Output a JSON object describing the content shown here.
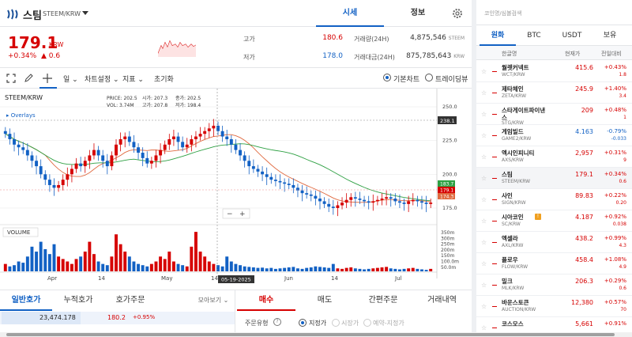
{
  "header": {
    "coin_name": "스팀",
    "pair": "STEEM/KRW",
    "tabs": [
      "시세",
      "정보"
    ]
  },
  "price": {
    "current": "179.1",
    "unit": "KRW",
    "change_pct": "+0.34%",
    "change_abs": "▲ 0.6",
    "high_label": "고가",
    "high": "180.6",
    "low_label": "저가",
    "low": "178.0",
    "volume_label": "거래량(24H)",
    "volume": "4,875,546",
    "volume_unit": "STEEM",
    "amount_label": "거래대금(24H)",
    "amount": "875,785,643",
    "amount_unit": "KRW"
  },
  "toolbar": {
    "period": "일",
    "chart_settings": "차트설정",
    "indicator": "지표",
    "reset": "초기화",
    "basic_chart": "기본차트",
    "trading_view": "트레이딩뷰"
  },
  "chart_data": {
    "type": "candlestick",
    "title": "STEEM/KRW",
    "overlays_label": "Overlays",
    "ohlc_labels": {
      "price_label": "PRICE:",
      "price": "202.5",
      "open_label": "시가:",
      "open": "207.3",
      "close_label": "종가:",
      "close": "202.5",
      "vol_label": "VOL:",
      "vol": "3.74M",
      "high_label": "고가:",
      "high": "207.8",
      "low_label": "저가:",
      "low": "198.4"
    },
    "y_ticks": [
      "250.0",
      "225.0",
      "200.0",
      "175.0"
    ],
    "ylim": [
      165,
      260
    ],
    "crosshair_value": "238.1",
    "price_tags": [
      "183.7",
      "179.1",
      "174.3"
    ],
    "x_ticks": [
      "Apr",
      "14",
      "May",
      "14",
      "Jun",
      "14",
      "Jul"
    ],
    "crosshair_date": "05-19-2025",
    "volume_label": "VOLUME",
    "volume_ticks": [
      "350m",
      "300m",
      "250m",
      "200m",
      "150m",
      "100.0m",
      "50.0m"
    ],
    "closes": [
      230,
      226,
      222,
      220,
      218,
      214,
      210,
      206,
      200,
      196,
      192,
      190,
      192,
      196,
      200,
      204,
      208,
      206,
      210,
      214,
      218,
      214,
      210,
      206,
      214,
      222,
      226,
      228,
      224,
      220,
      216,
      212,
      208,
      210,
      214,
      218,
      222,
      226,
      228,
      224,
      220,
      222,
      226,
      228,
      230,
      232,
      234,
      236,
      232,
      228,
      226,
      222,
      218,
      214,
      210,
      206,
      204,
      202,
      200,
      198,
      196,
      195,
      194,
      193,
      192,
      190,
      188,
      186,
      185,
      184,
      182,
      180,
      178,
      176,
      175,
      177,
      179,
      181,
      183,
      182,
      181,
      180,
      179,
      180,
      181,
      182,
      183,
      182,
      180,
      179,
      178,
      180,
      181,
      180,
      179,
      178,
      179
    ],
    "volumes": [
      30,
      20,
      25,
      40,
      35,
      60,
      100,
      80,
      120,
      90,
      70,
      110,
      60,
      50,
      40,
      30,
      50,
      60,
      80,
      120,
      70,
      40,
      30,
      25,
      60,
      150,
      110,
      80,
      60,
      40,
      30,
      25,
      20,
      30,
      40,
      60,
      50,
      80,
      40,
      30,
      25,
      20,
      100,
      160,
      80,
      60,
      40,
      30,
      25,
      20,
      60,
      40,
      30,
      25,
      20,
      18,
      16,
      14,
      15,
      12,
      14,
      10,
      12,
      14,
      16,
      18,
      12,
      10,
      14,
      16,
      20,
      18,
      16,
      14,
      30,
      12,
      10,
      14,
      16,
      12,
      10,
      8,
      10,
      12,
      14,
      16,
      18,
      12,
      10,
      8,
      10,
      12,
      14,
      10,
      8,
      6,
      10
    ]
  },
  "bottom_tabs": {
    "left": [
      "일반호가",
      "누적호가",
      "호가주문"
    ],
    "view_more": "모아보기",
    "right": [
      "매수",
      "매도",
      "간편주문",
      "거래내역"
    ]
  },
  "orderbook": {
    "volume": "23,474.178",
    "price": "180.2",
    "pct": "+0.95%"
  },
  "order_form": {
    "type_label": "주문유형",
    "options": [
      "지정가",
      "시장가",
      "예약-지정가"
    ]
  },
  "market": {
    "search_placeholder": "코인명/심볼검색",
    "tabs": [
      "원화",
      "BTC",
      "USDT",
      "보유"
    ],
    "headers": [
      "한글명",
      "현재가",
      "전일대비"
    ],
    "rows": [
      {
        "name": "월렛커넥트",
        "pair": "WCT/KRW",
        "price": "415.6",
        "pct": "+0.43%",
        "diff": "1.8",
        "dir": "up"
      },
      {
        "name": "제타체인",
        "pair": "ZETA/KRW",
        "price": "245.9",
        "pct": "+1.40%",
        "diff": "3.4",
        "dir": "up"
      },
      {
        "name": "스타게이트파이낸스",
        "pair": "STG/KRW",
        "price": "209",
        "pct": "+0.48%",
        "diff": "1",
        "dir": "up"
      },
      {
        "name": "게임빌드",
        "pair": "GAME2/KRW",
        "price": "4.163",
        "pct": "-0.79%",
        "diff": "-0.033",
        "dir": "down"
      },
      {
        "name": "엑시인피니티",
        "pair": "AXS/KRW",
        "price": "2,957",
        "pct": "+0.31%",
        "diff": "9",
        "dir": "up"
      },
      {
        "name": "스팀",
        "pair": "STEEM/KRW",
        "price": "179.1",
        "pct": "+0.34%",
        "diff": "0.6",
        "dir": "up"
      },
      {
        "name": "사인",
        "pair": "SIGN/KRW",
        "price": "89.83",
        "pct": "+0.22%",
        "diff": "0.20",
        "dir": "up"
      },
      {
        "name": "시아코인",
        "pair": "SC/KRW",
        "price": "4.187",
        "pct": "+0.92%",
        "diff": "0.038",
        "dir": "up"
      },
      {
        "name": "엑셀라",
        "pair": "AXL/KRW",
        "price": "438.2",
        "pct": "+0.99%",
        "diff": "4.3",
        "dir": "up"
      },
      {
        "name": "플로우",
        "pair": "FLOW/KRW",
        "price": "458.4",
        "pct": "+1.08%",
        "diff": "4.9",
        "dir": "up"
      },
      {
        "name": "밀크",
        "pair": "MLK/KRW",
        "price": "206.3",
        "pct": "+0.29%",
        "diff": "0.6",
        "dir": "up"
      },
      {
        "name": "바운스토큰",
        "pair": "AUCTION/KRW",
        "price": "12,380",
        "pct": "+0.57%",
        "diff": "70",
        "dir": "up"
      },
      {
        "name": "코스모스",
        "pair": "",
        "price": "5,661",
        "pct": "+0.91%",
        "diff": "",
        "dir": "up"
      }
    ]
  },
  "colors": {
    "up": "#d60000",
    "down": "#1261c4",
    "accent": "#1261c4"
  }
}
